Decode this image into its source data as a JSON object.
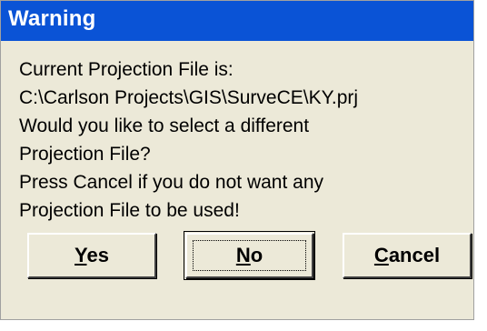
{
  "dialog": {
    "title": "Warning",
    "message_lines": [
      "Current Projection File is:",
      "C:\\Carlson Projects\\GIS\\SurveCE\\KY.prj",
      "Would you like to select a different",
      "Projection File?",
      "Press Cancel if you do not want any",
      "Projection File to be used!"
    ],
    "buttons": {
      "yes": {
        "mnemonic": "Y",
        "rest": "es"
      },
      "no": {
        "mnemonic": "N",
        "rest": "o"
      },
      "cancel": {
        "mnemonic": "C",
        "rest": "ancel"
      }
    },
    "colors": {
      "titlebar": "#0a53d6",
      "background": "#ece9d8"
    }
  }
}
